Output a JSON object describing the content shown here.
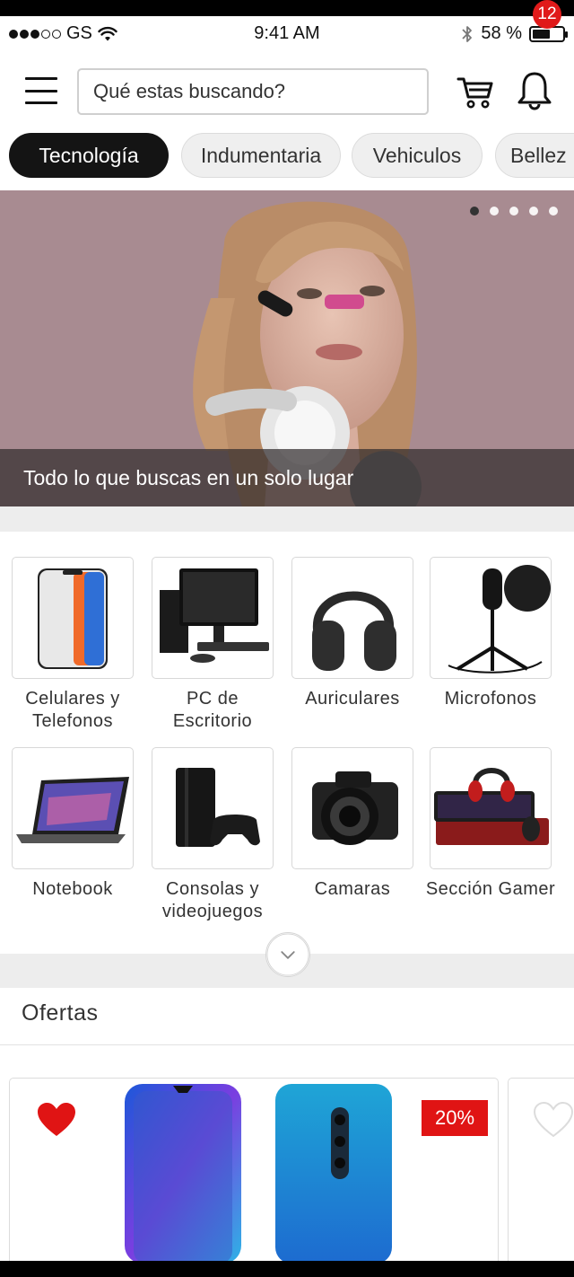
{
  "status_bar": {
    "carrier": "GS",
    "time": "9:41 AM",
    "battery": "58 %",
    "battery_level": 0.58
  },
  "header": {
    "search_placeholder": "Qué estas buscando?",
    "notification_count": "12"
  },
  "tabs": [
    {
      "label": "Tecnología",
      "active": true
    },
    {
      "label": "Indumentaria",
      "active": false
    },
    {
      "label": "Vehiculos",
      "active": false
    },
    {
      "label": "Bellez",
      "active": false
    }
  ],
  "banner": {
    "caption": "Todo lo que buscas en un solo lugar",
    "slide_count": 5,
    "current_slide": 1
  },
  "categories": [
    {
      "label": "Celulares y\nTelefonos",
      "icon": "smartphone-icon"
    },
    {
      "label": "PC de Escritorio",
      "icon": "desktop-pc-icon"
    },
    {
      "label": "Auriculares",
      "icon": "headphones-icon"
    },
    {
      "label": "Microfonos",
      "icon": "microphone-icon"
    },
    {
      "label": "Notebook",
      "icon": "laptop-icon"
    },
    {
      "label": "Consolas y\nvideojuegos",
      "icon": "console-icon"
    },
    {
      "label": "Camaras",
      "icon": "camera-icon"
    },
    {
      "label": "Sección Gamer",
      "icon": "gamer-kit-icon"
    }
  ],
  "ofertas": {
    "title": "Ofertas",
    "items": [
      {
        "favorite": true,
        "discount": "20%"
      },
      {
        "favorite": false,
        "discount": ""
      }
    ]
  },
  "colors": {
    "accent_red": "#e01414",
    "tab_active": "#141414",
    "banner_bg": "#a88b91"
  }
}
